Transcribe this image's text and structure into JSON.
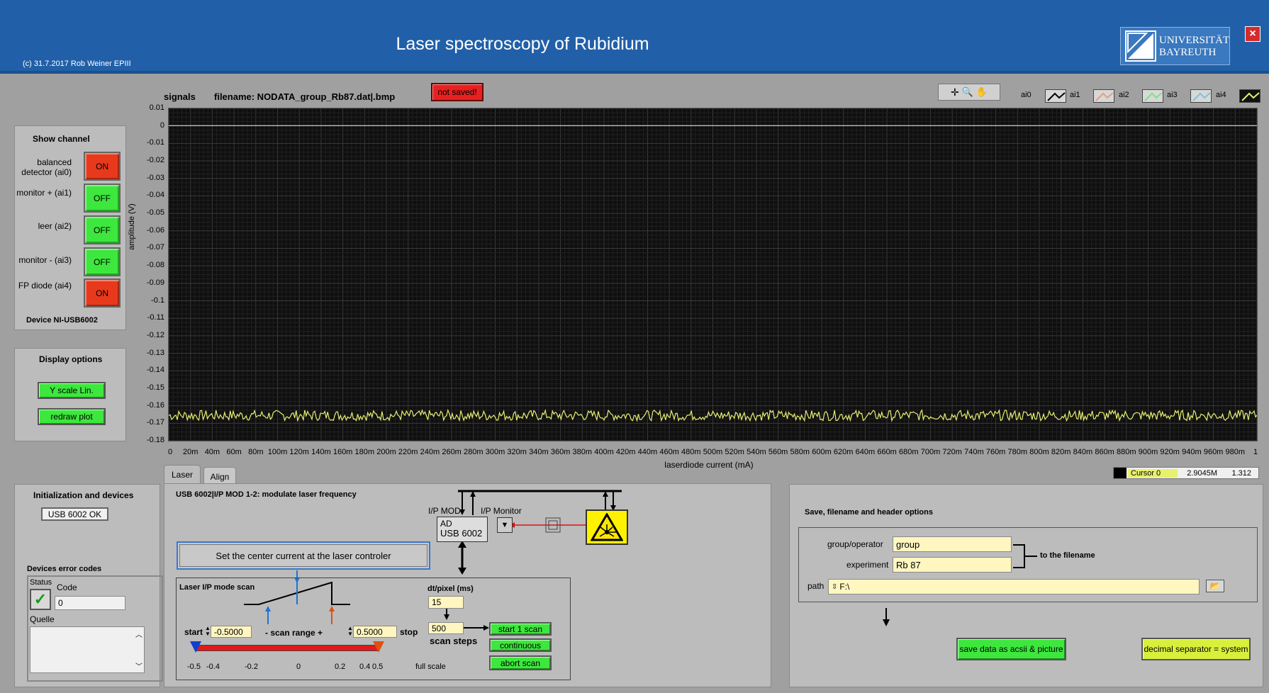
{
  "header": {
    "title": "Laser spectroscopy of Rubidium",
    "copyright": "(c) 31.7.2017 Rob Weiner EPIII",
    "logo_line1": "UNIVERSITÄT",
    "logo_line2": "BAYREUTH"
  },
  "graph": {
    "label": "signals",
    "filename": "filename: NODATA_group_Rb87.dat|.bmp",
    "save_status": "not saved!",
    "ylabel": "amplitude (V)",
    "xlabel": "laserdiode current (mA)",
    "legend": [
      "ai0",
      "ai1",
      "ai2",
      "ai3",
      "ai4"
    ],
    "legend_colors": [
      "#000000",
      "#e0a080",
      "#80e080",
      "#80c0e0",
      "#e8f070"
    ],
    "cursor": {
      "name": "Cursor 0",
      "x": "2.9045M",
      "y": "1.312"
    }
  },
  "chart_data": {
    "type": "line",
    "x_ticks": [
      "0",
      "20m",
      "40m",
      "60m",
      "80m",
      "100m",
      "120m",
      "140m",
      "160m",
      "180m",
      "200m",
      "220m",
      "240m",
      "260m",
      "280m",
      "300m",
      "320m",
      "340m",
      "360m",
      "380m",
      "400m",
      "420m",
      "440m",
      "460m",
      "480m",
      "500m",
      "520m",
      "540m",
      "560m",
      "580m",
      "600m",
      "620m",
      "640m",
      "660m",
      "680m",
      "700m",
      "720m",
      "740m",
      "760m",
      "780m",
      "800m",
      "820m",
      "840m",
      "860m",
      "880m",
      "900m",
      "920m",
      "940m",
      "960m",
      "980m",
      "1"
    ],
    "y_ticks": [
      "0.01",
      "0",
      "-0.01",
      "-0.02",
      "-0.03",
      "-0.04",
      "-0.05",
      "-0.06",
      "-0.07",
      "-0.08",
      "-0.09",
      "-0.1",
      "-0.11",
      "-0.12",
      "-0.13",
      "-0.14",
      "-0.15",
      "-0.16",
      "-0.17",
      "-0.18"
    ],
    "xlim": [
      0,
      1
    ],
    "ylim": [
      -0.18,
      0.01
    ],
    "grid": true,
    "series": [
      {
        "name": "ai0",
        "color": "#f0f0f0",
        "x": [
          0,
          1
        ],
        "y": [
          0.0002,
          0.0002
        ]
      },
      {
        "name": "ai4",
        "color": "#e8f070",
        "x": [
          0,
          1
        ],
        "y": [
          -0.1655,
          -0.1655
        ],
        "noise": 0.003
      }
    ]
  },
  "show_channel": {
    "title": "Show channel",
    "channels": [
      {
        "label": "balanced detector (ai0)",
        "state": "ON"
      },
      {
        "label": "monitor + (ai1)",
        "state": "OFF"
      },
      {
        "label": "leer (ai2)",
        "state": "OFF"
      },
      {
        "label": "monitor - (ai3)",
        "state": "OFF"
      },
      {
        "label": "FP diode (ai4)",
        "state": "ON"
      }
    ],
    "device": "Device NI-USB6002"
  },
  "display_options": {
    "title": "Display options",
    "yscale": "Y scale Lin.",
    "redraw": "redraw plot"
  },
  "init": {
    "title": "Initialization and devices",
    "status_btn": "USB 6002 OK",
    "errors_title": "Devices error codes",
    "status_label": "Status",
    "code_label": "Code",
    "code_value": "0",
    "source_label": "Quelle"
  },
  "tabs": [
    "Laser",
    "Align"
  ],
  "laser": {
    "heading": "USB 6002|I/P MOD 1-2: modulate  laser frequency",
    "ip_mod": "I/P MOD",
    "ip_monitor": "I/P Monitor",
    "ad_line1": "AD",
    "ad_line2": "USB 6002",
    "center_btn": "Set the center current at the laser controler",
    "scan_title": "Laser I/P mode scan",
    "start_label": "start",
    "start_value": "-0.5000",
    "range_label": "- scan range +",
    "stop_value": "0.5000",
    "stop_label": "stop",
    "dt_label": "dt/pixel (ms)",
    "dt_value": "15",
    "steps_value": "500",
    "steps_label": "scan steps",
    "start1_btn": "start 1 scan",
    "continuous_btn": "continuous",
    "abort_btn": "abort scan",
    "slider_ticks": [
      "-0.5",
      "-0.4",
      "-0.2",
      "0",
      "0.2",
      "0.4",
      "0.5"
    ],
    "full_scale": "full scale",
    "slider_low": -0.5,
    "slider_high": 0.5
  },
  "save": {
    "title": "Save, filename and header options",
    "group_label": "group/operator",
    "group_value": "group",
    "experiment_label": "experiment",
    "experiment_value": "Rb 87",
    "to_filename": "to the filename",
    "path_label": "path",
    "path_value": "F:\\",
    "save_btn": "save data as acsii &  picture",
    "decimal_btn": "decimal separator = system"
  }
}
